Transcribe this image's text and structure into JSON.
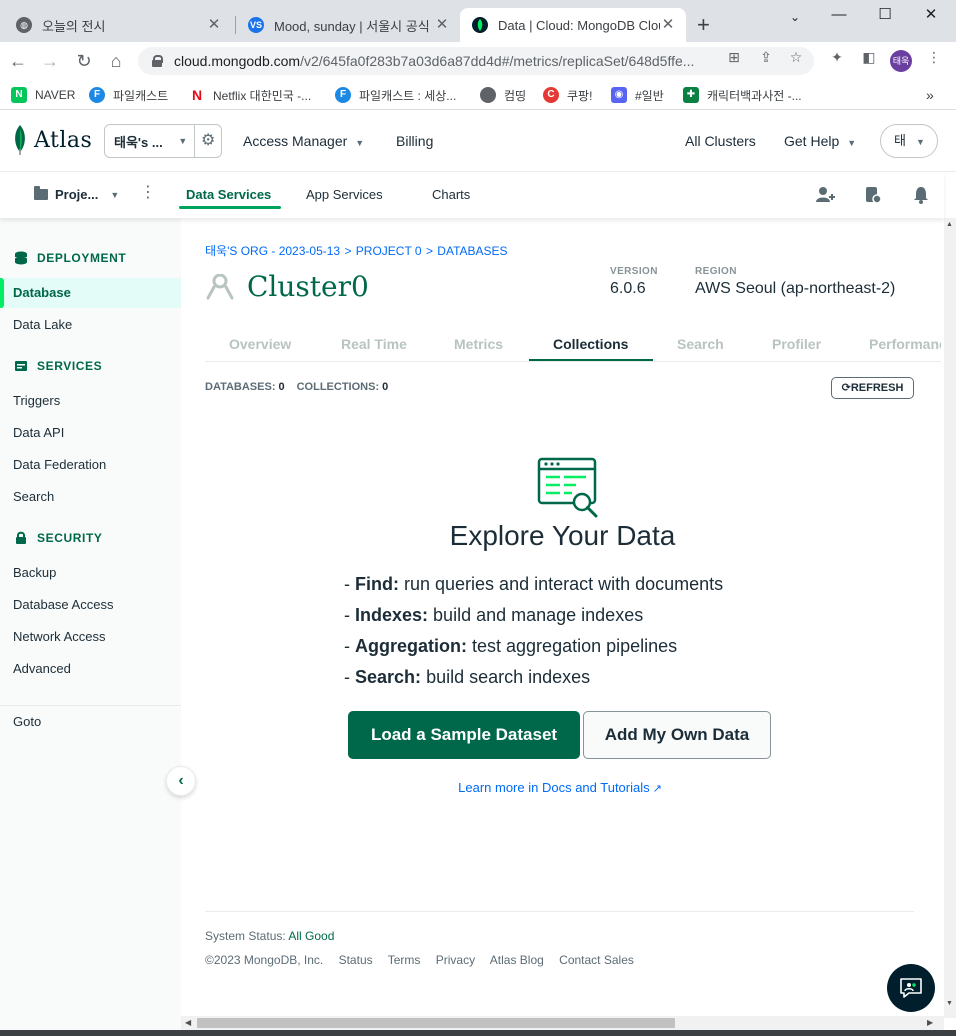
{
  "browser": {
    "tabs": [
      {
        "title": "오늘의 전시",
        "favicon": "globe-icon"
      },
      {
        "title": "Mood, sunday | 서울시 공식 관",
        "favicon": "vs-icon"
      },
      {
        "title": "Data | Cloud: MongoDB Cloud",
        "favicon": "mongodb-leaf-icon"
      }
    ],
    "url_host": "cloud.mongodb.com",
    "url_path": "/v2/645fa0f283b7a03d6a87dd4d#/metrics/replicaSet/648d5ffe...",
    "profile_initials": "태욱",
    "bookmarks": [
      {
        "label": "NAVER",
        "icon": "naver-icon",
        "color": "#03c75a",
        "glyph": "N"
      },
      {
        "label": "파일캐스트",
        "icon": "filecast-icon",
        "color": "#1e88e5",
        "glyph": "F"
      },
      {
        "label": "Netflix 대한민국 -...",
        "icon": "netflix-icon",
        "color": "#e50914",
        "glyph": "N"
      },
      {
        "label": "파일캐스트 : 세상...",
        "icon": "filecast-icon",
        "color": "#1e88e5",
        "glyph": "F"
      },
      {
        "label": "컴띵",
        "icon": "globe-icon",
        "color": "#5f6368",
        "glyph": "●"
      },
      {
        "label": "쿠팡!",
        "icon": "coupang-icon",
        "color": "#e53935",
        "glyph": "C"
      },
      {
        "label": "#일반",
        "icon": "discord-icon",
        "color": "#5865f2",
        "glyph": "◉"
      },
      {
        "label": "캐릭터백과사전 -...",
        "icon": "plus-book-icon",
        "color": "#0b8043",
        "glyph": "✚"
      }
    ]
  },
  "atlas": {
    "logo_text": "Atlas",
    "org_name": "태욱's ...",
    "nav": {
      "access_manager": "Access Manager",
      "billing": "Billing",
      "all_clusters": "All Clusters",
      "get_help": "Get Help",
      "user": "태"
    },
    "project": {
      "name": "Proje...",
      "tabs": [
        "Data Services",
        "App Services",
        "Charts"
      ]
    }
  },
  "sidebar": {
    "sections": [
      {
        "title": "DEPLOYMENT",
        "icon": "database-stack-icon",
        "items": [
          "Database",
          "Data Lake"
        ]
      },
      {
        "title": "SERVICES",
        "icon": "services-icon",
        "items": [
          "Triggers",
          "Data API",
          "Data Federation",
          "Search"
        ]
      },
      {
        "title": "SECURITY",
        "icon": "lock-icon",
        "items": [
          "Backup",
          "Database Access",
          "Network Access",
          "Advanced"
        ]
      }
    ],
    "goto": "Goto",
    "active_item": "Database"
  },
  "main": {
    "breadcrumbs": [
      "태욱'S ORG - 2023-05-13",
      "PROJECT 0",
      "DATABASES"
    ],
    "cluster_name": "Cluster0",
    "version_label": "VERSION",
    "version_value": "6.0.6",
    "region_label": "REGION",
    "region_value": "AWS Seoul (ap-northeast-2)",
    "tabs": [
      "Overview",
      "Real Time",
      "Metrics",
      "Collections",
      "Search",
      "Profiler",
      "Performance Advisor"
    ],
    "active_tab": "Collections",
    "databases_label": "DATABASES:",
    "databases_count": "0",
    "collections_label": "COLLECTIONS:",
    "collections_count": "0",
    "refresh_label": "REFRESH",
    "explore_title": "Explore Your Data",
    "features": [
      {
        "term": "Find:",
        "desc": "run queries and interact with documents"
      },
      {
        "term": "Indexes:",
        "desc": "build and manage indexes"
      },
      {
        "term": "Aggregation:",
        "desc": "test aggregation pipelines"
      },
      {
        "term": "Search:",
        "desc": "build search indexes"
      }
    ],
    "load_sample_label": "Load a Sample Dataset",
    "add_own_label": "Add My Own Data",
    "learn_more": "Learn more in Docs and Tutorials",
    "system_status_label": "System Status:",
    "system_status_value": "All Good",
    "footer_links": [
      "©2023 MongoDB, Inc.",
      "Status",
      "Terms",
      "Privacy",
      "Atlas Blog",
      "Contact Sales"
    ]
  },
  "colors": {
    "brand_green": "#00684a",
    "accent_green": "#00ed64",
    "link_blue": "#016bf8",
    "dark": "#001e2b"
  }
}
